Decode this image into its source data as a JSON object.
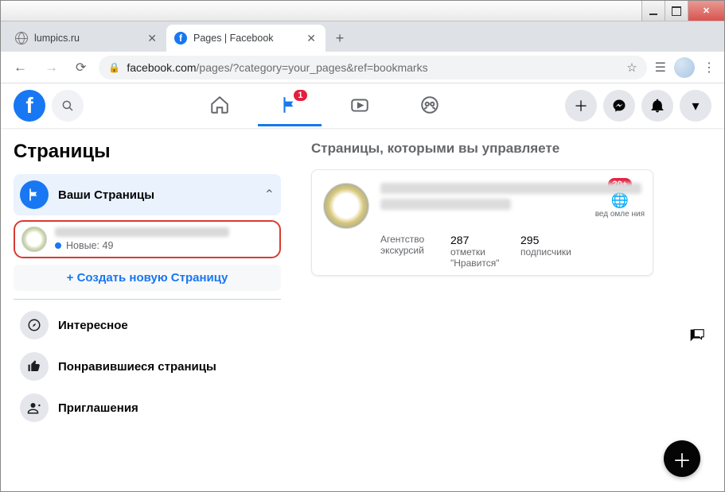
{
  "window": {
    "title": "Pages | Facebook"
  },
  "tabs": [
    {
      "title": "lumpics.ru",
      "active": false
    },
    {
      "title": "Pages | Facebook",
      "active": true
    }
  ],
  "address": {
    "domain": "facebook.com",
    "path": "/pages/?category=your_pages&ref=bookmarks"
  },
  "fb_nav": {
    "pages_badge": "1"
  },
  "sidebar": {
    "heading": "Страницы",
    "your_pages": "Ваши Страницы",
    "new_label": "Новые: 49",
    "create_label": "+  Создать новую Страницу",
    "items": {
      "discover": "Интересное",
      "liked": "Понравившиеся страницы",
      "invites": "Приглашения"
    }
  },
  "main": {
    "heading": "Страницы, которыми вы управляете",
    "notif_badge": "20+",
    "notif_label": "вед омле ния",
    "category": "Агентство экскурсий",
    "likes_count": "287",
    "likes_label": "отметки \"Нравится\"",
    "followers_count": "295",
    "followers_label": "подписчики"
  }
}
